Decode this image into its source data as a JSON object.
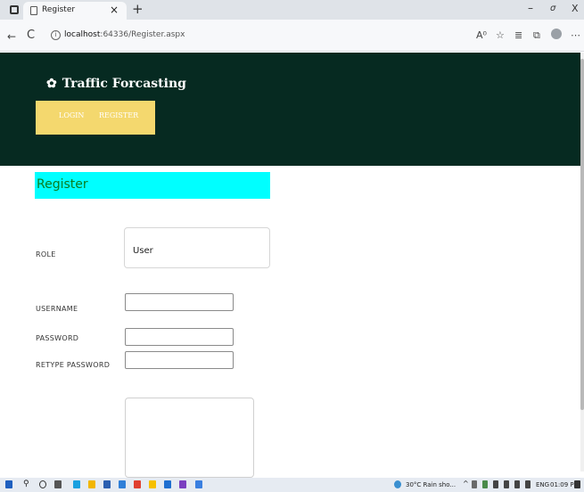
{
  "browser": {
    "tab_title": "Register",
    "tab_close": "×",
    "new_tab": "+",
    "url_host": "localhost",
    "url_rest": ":64336/Register.aspx",
    "win_min": "–",
    "win_max": "σ",
    "win_close": "X",
    "info_glyph": "i",
    "toolbar_icons": [
      "A⁰",
      "☆",
      "≣",
      "⧉",
      "⋯"
    ]
  },
  "header": {
    "brand": "Traffic Forcasting",
    "nav": {
      "login": "LOGIN",
      "register": "REGISTER"
    },
    "bg_color": "#062a21",
    "nav_color": "#f4d86e"
  },
  "form": {
    "title": "Register",
    "title_bg": "#00ffff",
    "role_label": "ROLE",
    "role_value": "User",
    "username_label": "USERNAME",
    "password_label": "PASSWORD",
    "retype_label": "RETYPE PASSWORD"
  },
  "taskbar": {
    "weather": "30°C  Rain sho...",
    "lang": "ENG",
    "time": "01:09 PM"
  }
}
